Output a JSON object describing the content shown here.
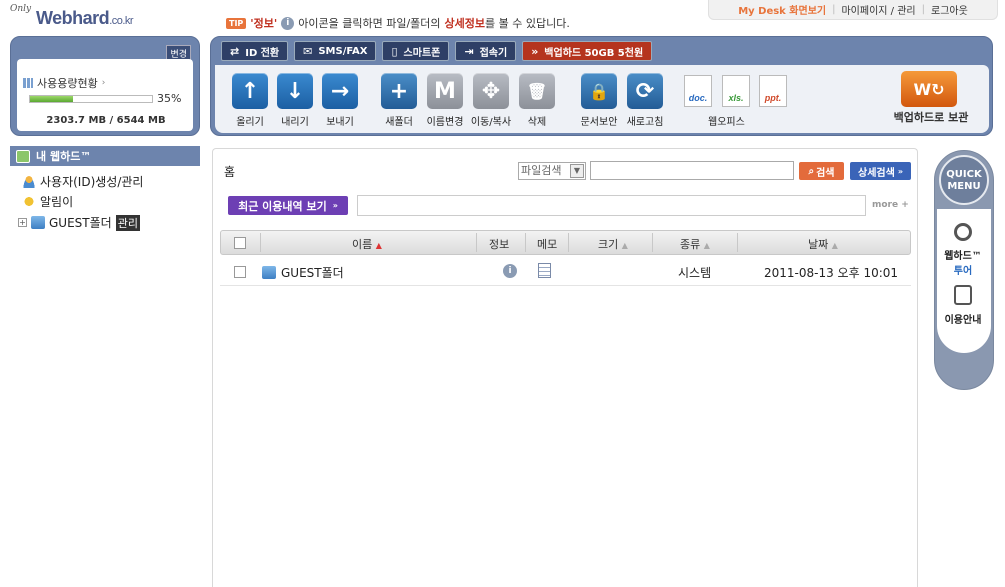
{
  "logo": {
    "only": "Only",
    "name": "Webhard",
    "tld": ".co.kr"
  },
  "tip": {
    "badge": "TIP",
    "quote": "'정보'",
    "pre": "아이콘을 클릭하면 파일/폴더의",
    "highlight": "상세정보",
    "post": "를 볼 수 있답니다."
  },
  "toplinks": {
    "mydesk": "My Desk 화면보기",
    "mypage": "마이페이지 / 관리",
    "logout": "로그아웃",
    "sep": "|"
  },
  "storage": {
    "change": "변경",
    "title": "사용용량현황",
    "percent": "35%",
    "percent_value": 35,
    "usage": "2303.7 MB / 6544 MB"
  },
  "toolbar": {
    "tabs": [
      {
        "label": "ID 전환",
        "icon": "swap-icon"
      },
      {
        "label": "SMS/FAX",
        "icon": "sms-icon"
      },
      {
        "label": "스마트폰",
        "icon": "phone-icon"
      },
      {
        "label": "접속기",
        "icon": "connect-icon"
      },
      {
        "label": "백업하드 50GB 5천원",
        "icon": "double-arrow-icon"
      }
    ],
    "tools": [
      {
        "label": "올리기",
        "glyph": "↑"
      },
      {
        "label": "내리기",
        "glyph": "↓"
      },
      {
        "label": "보내기",
        "glyph": "→"
      },
      {
        "label": "새폴더",
        "glyph": "+"
      },
      {
        "label": "이름변경",
        "glyph": "M"
      },
      {
        "label": "이동/복사",
        "glyph": "✥"
      },
      {
        "label": "삭제",
        "glyph": "🗑"
      },
      {
        "label": "문서보안",
        "glyph": "🔒"
      },
      {
        "label": "새로고침",
        "glyph": "⟳"
      }
    ],
    "docs": [
      "doc.",
      "xls.",
      "ppt."
    ],
    "weboffice": "웹오피스",
    "backup": "백업하드로 보관"
  },
  "sidebar": {
    "title": "내 웹하드™",
    "items": [
      {
        "label": "사용자(ID)생성/관리"
      },
      {
        "label": "알림이"
      },
      {
        "label": "GUEST폴더",
        "badge": "관리",
        "expand": "+"
      }
    ]
  },
  "main": {
    "breadcrumb": "홈",
    "search_select": "파일검색",
    "search_placeholder": "",
    "search_button": "검색",
    "advanced_button": "상세검색",
    "recent_button": "최근 이용내역 보기",
    "more": "more +",
    "columns": [
      "이름",
      "정보",
      "메모",
      "크기",
      "종류",
      "날짜"
    ],
    "rows": [
      {
        "name": "GUEST폴더",
        "size": "",
        "type": "시스템",
        "date": "2011-08-13 오후 10:01"
      }
    ]
  },
  "quick": {
    "title_line1": "QUICK",
    "title_line2": "MENU",
    "item1_line1": "웹하드™",
    "item1_line2": "투어",
    "item2": "이용안내"
  }
}
